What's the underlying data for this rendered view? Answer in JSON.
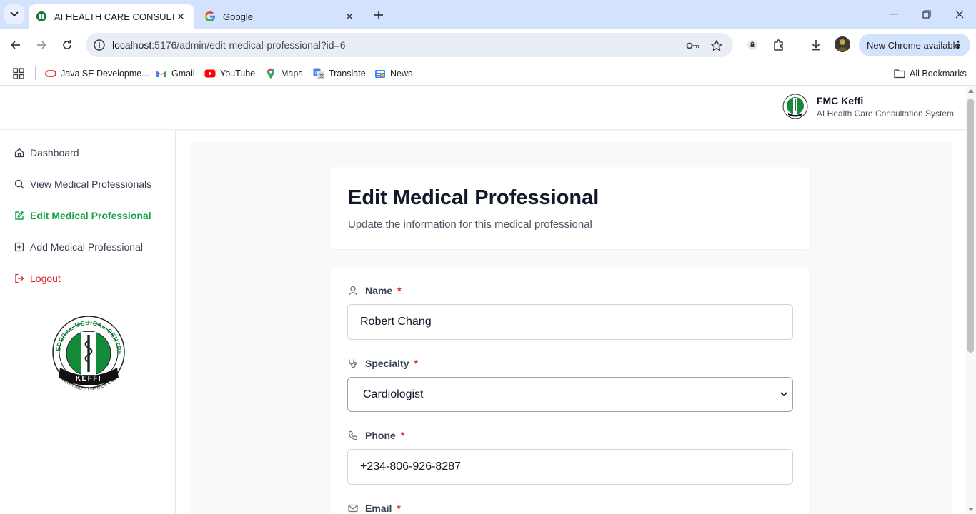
{
  "browser": {
    "tabs": [
      {
        "title": "AI HEALTH CARE CONSULTATIO",
        "active": true
      },
      {
        "title": "Google",
        "active": false
      }
    ],
    "url_host": "localhost",
    "url_path": ":5176/admin/edit-medical-professional?id=6",
    "new_chrome_label": "New Chrome available",
    "bookmarks": [
      {
        "label": "Java SE Developme...",
        "icon": "oracle-icon"
      },
      {
        "label": "Gmail",
        "icon": "gmail-icon"
      },
      {
        "label": "YouTube",
        "icon": "youtube-icon"
      },
      {
        "label": "Maps",
        "icon": "maps-icon"
      },
      {
        "label": "Translate",
        "icon": "translate-icon"
      },
      {
        "label": "News",
        "icon": "news-icon"
      }
    ],
    "all_bookmarks_label": "All Bookmarks"
  },
  "header": {
    "org_name": "FMC Keffi",
    "system_name": "AI Health Care Consultation System"
  },
  "sidebar": {
    "items": [
      {
        "label": "Dashboard",
        "icon": "home-icon"
      },
      {
        "label": "View Medical Professionals",
        "icon": "search-icon"
      },
      {
        "label": "Edit Medical Professional",
        "icon": "edit-icon",
        "active": true
      },
      {
        "label": "Add Medical Professional",
        "icon": "plus-square-icon"
      },
      {
        "label": "Logout",
        "icon": "logout-icon"
      }
    ],
    "logo_text": {
      "top": "FEDERAL MEDICAL CENTRE",
      "band": "KEFFI",
      "bottom": "COMMITTED TO SERVE & CARE"
    }
  },
  "page": {
    "title": "Edit Medical Professional",
    "subtitle": "Update the information for this medical professional"
  },
  "form": {
    "name_label": "Name",
    "name_value": "Robert Chang",
    "specialty_label": "Specialty",
    "specialty_value": "Cardiologist",
    "phone_label": "Phone",
    "phone_value": "+234-806-926-8287",
    "email_label": "Email",
    "required_marker": "*"
  },
  "colors": {
    "accent": "#16a34a",
    "danger": "#dc2626",
    "tabstrip": "#d3e3fd"
  }
}
